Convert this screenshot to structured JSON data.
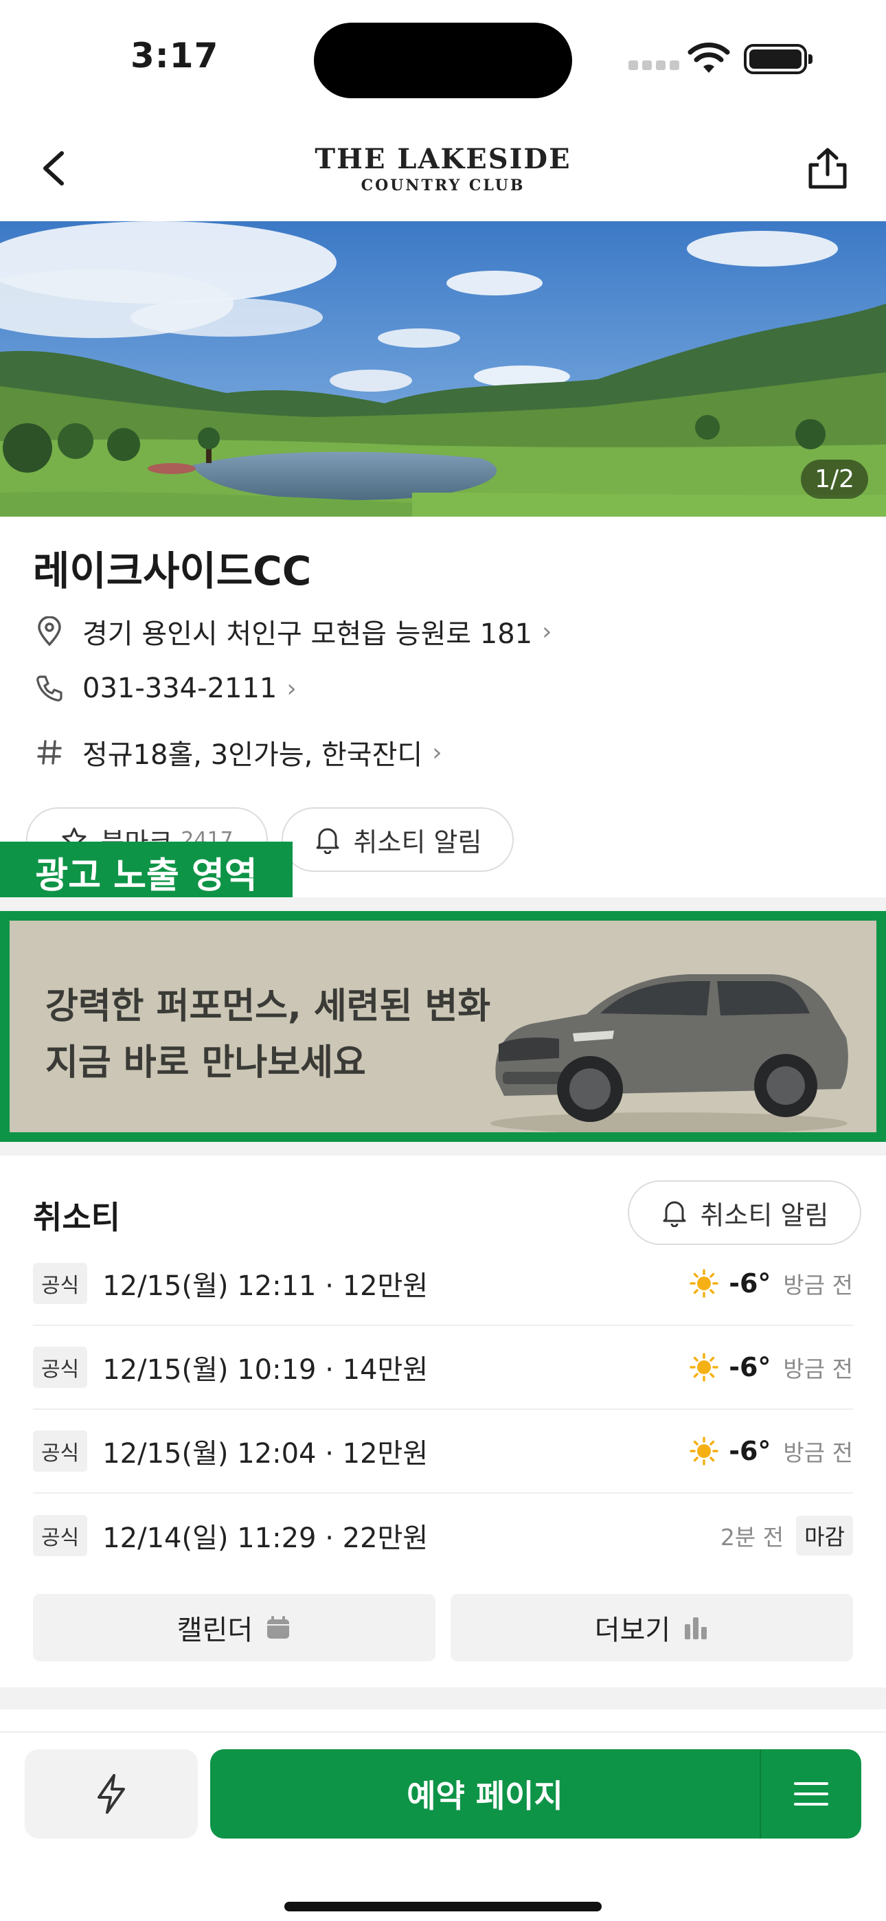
{
  "status_bar": {
    "time": "3:17"
  },
  "header": {
    "logo_main": "THE LAKESIDE",
    "logo_sub": "COUNTRY CLUB"
  },
  "hero": {
    "page_indicator": "1/2"
  },
  "course": {
    "name": "레이크사이드CC",
    "address": "경기 용인시 처인구 모현읍 능원로 181",
    "phone": "031-334-2111",
    "tags": "정규18홀, 3인가능, 한국잔디"
  },
  "actions": {
    "bookmark_label": "북마크",
    "bookmark_count": "2417",
    "cancel_alert_label": "취소티 알림"
  },
  "ad": {
    "label": "광고 노출 영역",
    "line1": "강력한 퍼포먼스, 세련된 변화",
    "line2": "지금 바로 만나보세요"
  },
  "cancel_tee": {
    "title": "취소티",
    "alert_label": "취소티 알림",
    "rows": [
      {
        "badge": "공식",
        "text": "12/15(월) 12:11 · 12만원",
        "temp": "-6°",
        "ago": "방금 전",
        "weather": "sunny"
      },
      {
        "badge": "공식",
        "text": "12/15(월) 10:19 · 14만원",
        "temp": "-6°",
        "ago": "방금 전",
        "weather": "sunny"
      },
      {
        "badge": "공식",
        "text": "12/15(월) 12:04 · 12만원",
        "temp": "-6°",
        "ago": "방금 전",
        "weather": "sunny"
      },
      {
        "badge": "공식",
        "text": "12/14(일) 11:29 · 22만원",
        "ago": "2분 전",
        "status": "마감"
      }
    ],
    "calendar_label": "캘린더",
    "more_label": "더보기"
  },
  "footer": {
    "book_label": "예약 페이지"
  },
  "colors": {
    "brand_green": "#0e9447",
    "sun": "#f5b014"
  },
  "icons": [
    "back-icon",
    "share-icon",
    "location-pin-icon",
    "phone-icon",
    "hash-icon",
    "star-icon",
    "bell-icon",
    "sun-icon",
    "calendar-icon",
    "bar-chart-icon",
    "lightning-icon",
    "hamburger-menu-icon"
  ]
}
